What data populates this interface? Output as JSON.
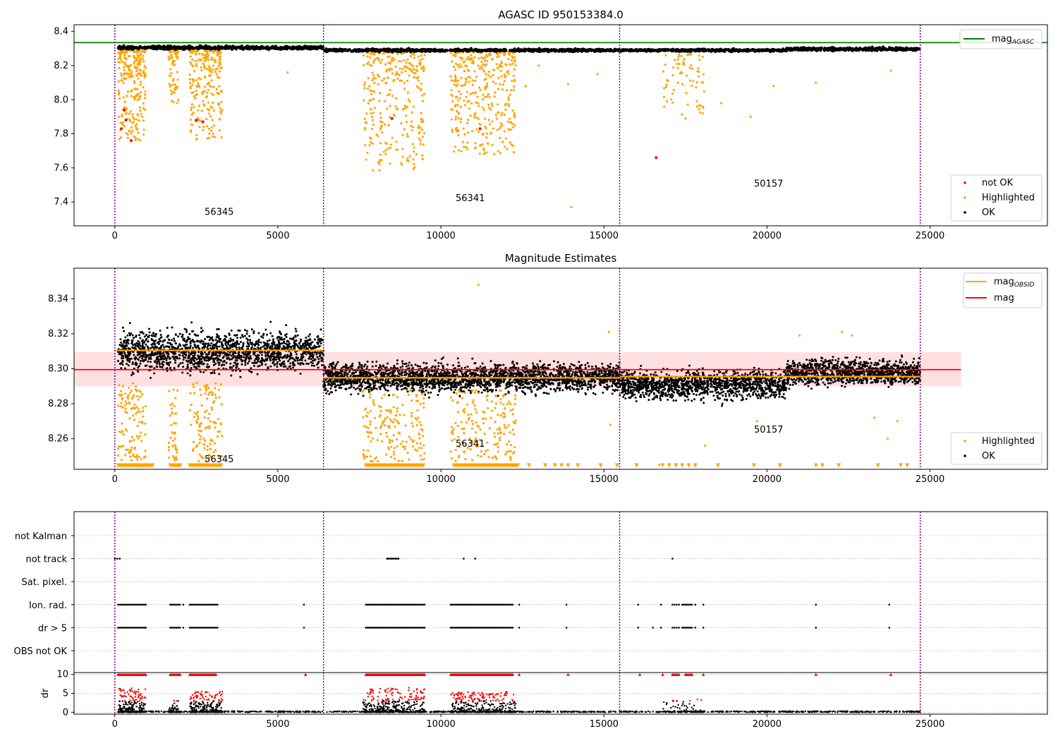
{
  "figure": {
    "background": "#ffffff"
  },
  "colors": {
    "ok": "#000000",
    "highlighted": "#ffa500",
    "not_ok": "#ff0000",
    "mag_agasc": "#008000",
    "mag": "#ff0000",
    "mag_obsid": "#ffa500",
    "obs_boundary": "#800080",
    "band": "#ffcccc"
  },
  "chart_data": [
    {
      "type": "scatter",
      "title": "AGASC ID 950153384.0",
      "xlim": [
        -1250,
        28600
      ],
      "ylim": [
        7.26,
        8.44
      ],
      "x_ticks": [
        0,
        5000,
        10000,
        15000,
        20000,
        25000
      ],
      "y_ticks": [
        7.4,
        7.6,
        7.8,
        8.0,
        8.2,
        8.4
      ],
      "obs_boundaries": [
        0,
        6400,
        15480,
        24700
      ],
      "mag_agasc": 8.335,
      "obsid_labels": [
        {
          "text": "56345",
          "x": 3200,
          "y": 7.325
        },
        {
          "text": "56341",
          "x": 10900,
          "y": 7.405
        },
        {
          "text": "50157",
          "x": 20050,
          "y": 7.49
        }
      ],
      "legend_lines": [
        {
          "name": "mag",
          "subscript": "AGASC",
          "color": "#008000"
        }
      ],
      "legend_points": [
        {
          "name": "not OK",
          "color": "#ff0000"
        },
        {
          "name": "Highlighted",
          "color": "#ffa500"
        },
        {
          "name": "OK",
          "color": "#000000"
        }
      ],
      "legend_lines_position": "upper right",
      "legend_points_position": "lower right",
      "series": [
        {
          "name": "OK",
          "segments": [
            {
              "x0": 100,
              "x1": 6400,
              "center": 8.305,
              "spread": 0.013
            },
            {
              "x0": 6400,
              "x1": 15480,
              "center": 8.29,
              "spread": 0.01
            },
            {
              "x0": 15480,
              "x1": 20600,
              "center": 8.29,
              "spread": 0.009
            },
            {
              "x0": 20600,
              "x1": 24700,
              "center": 8.297,
              "spread": 0.012
            }
          ]
        },
        {
          "name": "Highlighted",
          "clusters": [
            {
              "x0": 100,
              "x1": 950,
              "min": 7.76,
              "max": 8.29,
              "n": 240
            },
            {
              "x0": 1650,
              "x1": 1950,
              "min": 7.98,
              "max": 8.29,
              "n": 60
            },
            {
              "x0": 2300,
              "x1": 3300,
              "min": 7.74,
              "max": 8.29,
              "n": 230
            },
            {
              "x0": 7600,
              "x1": 9500,
              "min": 7.58,
              "max": 8.29,
              "n": 340
            },
            {
              "x0": 10300,
              "x1": 12300,
              "min": 7.68,
              "max": 8.29,
              "n": 380
            },
            {
              "x0": 16800,
              "x1": 18100,
              "min": 7.9,
              "max": 8.27,
              "n": 70
            }
          ],
          "isolated": [
            {
              "x": 5300,
              "y": 8.16
            },
            {
              "x": 12600,
              "y": 8.08
            },
            {
              "x": 13000,
              "y": 8.2
            },
            {
              "x": 13900,
              "y": 8.09
            },
            {
              "x": 14000,
              "y": 7.37
            },
            {
              "x": 14800,
              "y": 8.15
            },
            {
              "x": 17500,
              "y": 7.89
            },
            {
              "x": 18600,
              "y": 7.98
            },
            {
              "x": 19500,
              "y": 7.9
            },
            {
              "x": 20200,
              "y": 8.08
            },
            {
              "x": 21500,
              "y": 8.1
            },
            {
              "x": 23800,
              "y": 8.17
            }
          ]
        },
        {
          "name": "not OK",
          "points": [
            {
              "x": 200,
              "y": 7.83
            },
            {
              "x": 280,
              "y": 7.94
            },
            {
              "x": 340,
              "y": 7.88
            },
            {
              "x": 500,
              "y": 7.76
            },
            {
              "x": 2500,
              "y": 7.88
            },
            {
              "x": 2700,
              "y": 7.87
            },
            {
              "x": 8500,
              "y": 7.89
            },
            {
              "x": 11200,
              "y": 7.83
            },
            {
              "x": 16600,
              "y": 7.66
            }
          ]
        }
      ]
    },
    {
      "type": "scatter",
      "title": "Magnitude Estimates",
      "xlim": [
        -1250,
        28600
      ],
      "ylim": [
        8.2425,
        8.3575
      ],
      "x_ticks": [
        0,
        5000,
        10000,
        15000,
        20000,
        25000
      ],
      "y_ticks": [
        8.26,
        8.28,
        8.3,
        8.32,
        8.34
      ],
      "obs_boundaries": [
        0,
        6400,
        15480,
        24700
      ],
      "mag": 8.2995,
      "mag_band": [
        8.29,
        8.3095
      ],
      "mag_line_xlim": [
        -1250,
        25950
      ],
      "mag_obsid": [
        {
          "x0": 0,
          "x1": 6400,
          "value": 8.3105
        },
        {
          "x0": 6400,
          "x1": 15480,
          "value": 8.2948
        },
        {
          "x0": 15480,
          "x1": 24700,
          "value": 8.2955
        }
      ],
      "obsid_labels": [
        {
          "text": "56345",
          "x": 3200,
          "y": 8.2465
        },
        {
          "text": "56341",
          "x": 10900,
          "y": 8.2555
        },
        {
          "text": "50157",
          "x": 20050,
          "y": 8.2635
        }
      ],
      "legend_lines": [
        {
          "name": "mag",
          "subscript": "OBSID",
          "color": "#ffa500"
        },
        {
          "name": "mag",
          "subscript": "",
          "color": "#ff0000"
        }
      ],
      "legend_points": [
        {
          "name": "Highlighted",
          "color": "#ffa500"
        },
        {
          "name": "OK",
          "color": "#000000"
        }
      ],
      "legend_lines_position": "upper right",
      "legend_points_position": "lower right",
      "series": [
        {
          "name": "OK",
          "segments": [
            {
              "x0": 100,
              "x1": 6400,
              "center": 8.31,
              "spread": 0.011
            },
            {
              "x0": 6400,
              "x1": 15480,
              "center": 8.295,
              "spread": 0.008
            },
            {
              "x0": 15480,
              "x1": 20600,
              "center": 8.291,
              "spread": 0.008
            },
            {
              "x0": 20600,
              "x1": 24700,
              "center": 8.298,
              "spread": 0.007
            }
          ]
        },
        {
          "name": "Highlighted",
          "clusters": [
            {
              "x0": 100,
              "x1": 950,
              "min": 8.247,
              "max": 8.292,
              "n": 110
            },
            {
              "x0": 1650,
              "x1": 1950,
              "min": 8.247,
              "max": 8.29,
              "n": 40
            },
            {
              "x0": 2300,
              "x1": 3300,
              "min": 8.247,
              "max": 8.292,
              "n": 110
            },
            {
              "x0": 7600,
              "x1": 9500,
              "min": 8.247,
              "max": 8.288,
              "n": 170
            },
            {
              "x0": 10300,
              "x1": 12300,
              "min": 8.247,
              "max": 8.288,
              "n": 180
            }
          ],
          "isolated": [
            {
              "x": 11150,
              "y": 8.348
            },
            {
              "x": 15150,
              "y": 8.321
            },
            {
              "x": 22300,
              "y": 8.321
            },
            {
              "x": 22600,
              "y": 8.319
            },
            {
              "x": 21000,
              "y": 8.319
            },
            {
              "x": 16700,
              "y": 8.245
            },
            {
              "x": 15200,
              "y": 8.268
            },
            {
              "x": 18100,
              "y": 8.256
            },
            {
              "x": 19700,
              "y": 8.27
            },
            {
              "x": 23300,
              "y": 8.272
            },
            {
              "x": 24000,
              "y": 8.27
            },
            {
              "x": 23700,
              "y": 8.26
            }
          ],
          "clipped_x": [
            100,
            250,
            400,
            550,
            700,
            850,
            1000,
            1700,
            1850,
            2300,
            2500,
            2700,
            2900,
            3100,
            7700,
            7900,
            8100,
            8300,
            8500,
            8700,
            8900,
            9100,
            9300,
            10400,
            10600,
            10800,
            11000,
            11200,
            11400,
            11600,
            11800,
            12000,
            12200,
            12700,
            13200,
            13500,
            13700,
            13900,
            14200,
            14900,
            15400,
            16000,
            16800,
            17000,
            17200,
            17400,
            17600,
            17800,
            18500,
            19600,
            20400,
            21500,
            21700,
            22200,
            23400,
            24100,
            24300
          ],
          "clipped_y": 8.2435
        }
      ]
    },
    {
      "type": "scatter",
      "title": "",
      "xlim": [
        -1250,
        28600
      ],
      "x_ticks": [
        0,
        5000,
        10000,
        15000,
        20000,
        25000
      ],
      "obs_boundaries": [
        0,
        6400,
        15480,
        24700
      ],
      "flag_labels": [
        "not Kalman",
        "not track",
        "Sat. pixel.",
        "Ion. rad.",
        "dr > 5",
        "OBS not OK"
      ],
      "flag_ranges": [
        {
          "flag": "not track",
          "ranges": [
            [
              0,
              150
            ],
            [
              8350,
              8700
            ],
            [
              10700,
              10750
            ],
            [
              11050,
              11100
            ],
            [
              17100,
              17130
            ]
          ]
        },
        {
          "flag": "Ion. rad.",
          "ranges": [
            [
              100,
              950
            ],
            [
              1700,
              2000
            ],
            [
              2100,
              2150
            ],
            [
              2300,
              3100
            ],
            [
              3150,
              3180
            ],
            [
              5800,
              5830
            ],
            [
              7700,
              9500
            ],
            [
              10300,
              12200
            ],
            [
              12400,
              12450
            ],
            [
              13850,
              13880
            ],
            [
              16050,
              16080
            ],
            [
              16750,
              16780
            ],
            [
              17100,
              17300
            ],
            [
              17400,
              17700
            ],
            [
              17800,
              17850
            ],
            [
              18050,
              18080
            ],
            [
              21500,
              21530
            ],
            [
              23750,
              23780
            ]
          ]
        },
        {
          "flag": "dr > 5",
          "ranges": [
            [
              100,
              950
            ],
            [
              1700,
              2000
            ],
            [
              2100,
              2150
            ],
            [
              2300,
              3100
            ],
            [
              3150,
              3180
            ],
            [
              5800,
              5830
            ],
            [
              7700,
              9500
            ],
            [
              10300,
              12200
            ],
            [
              12400,
              12450
            ],
            [
              13850,
              13880
            ],
            [
              16050,
              16080
            ],
            [
              16500,
              16530
            ],
            [
              16750,
              16780
            ],
            [
              17100,
              17300
            ],
            [
              17400,
              17700
            ],
            [
              17800,
              17850
            ],
            [
              18050,
              18080
            ],
            [
              21500,
              21530
            ],
            [
              23750,
              23780
            ]
          ]
        }
      ]
    },
    {
      "type": "scatter",
      "title": "",
      "ylabel": "dr",
      "xlim": [
        -1250,
        28600
      ],
      "ylim": [
        -0.5,
        10.5
      ],
      "x_ticks": [
        0,
        5000,
        10000,
        15000,
        20000,
        25000
      ],
      "y_ticks": [
        0,
        5,
        10
      ],
      "obs_boundaries": [
        0,
        6400,
        15480,
        24700
      ],
      "clip_value": 10,
      "series": [
        {
          "name": "dr",
          "baseline_max": 0.3,
          "bursts": [
            {
              "x0": 100,
              "x1": 950,
              "max": 6.5,
              "n": 230
            },
            {
              "x0": 1650,
              "x1": 1950,
              "max": 3.5,
              "n": 50
            },
            {
              "x0": 2300,
              "x1": 3300,
              "max": 5.5,
              "n": 230
            },
            {
              "x0": 7600,
              "x1": 9500,
              "max": 6.5,
              "n": 380
            },
            {
              "x0": 10300,
              "x1": 12300,
              "max": 5.5,
              "n": 380
            },
            {
              "x0": 16800,
              "x1": 18100,
              "max": 3.5,
              "n": 60
            }
          ],
          "clipped_ranges": [
            [
              100,
              950
            ],
            [
              1700,
              2000
            ],
            [
              2300,
              3100
            ],
            [
              5850,
              5870
            ],
            [
              7700,
              9500
            ],
            [
              10300,
              12200
            ],
            [
              12400,
              12420
            ],
            [
              13900,
              13920
            ],
            [
              16100,
              16120
            ],
            [
              16800,
              16820
            ],
            [
              17100,
              17300
            ],
            [
              17500,
              17700
            ],
            [
              18050,
              18070
            ],
            [
              21500,
              21520
            ],
            [
              23800,
              23820
            ]
          ]
        }
      ]
    }
  ]
}
